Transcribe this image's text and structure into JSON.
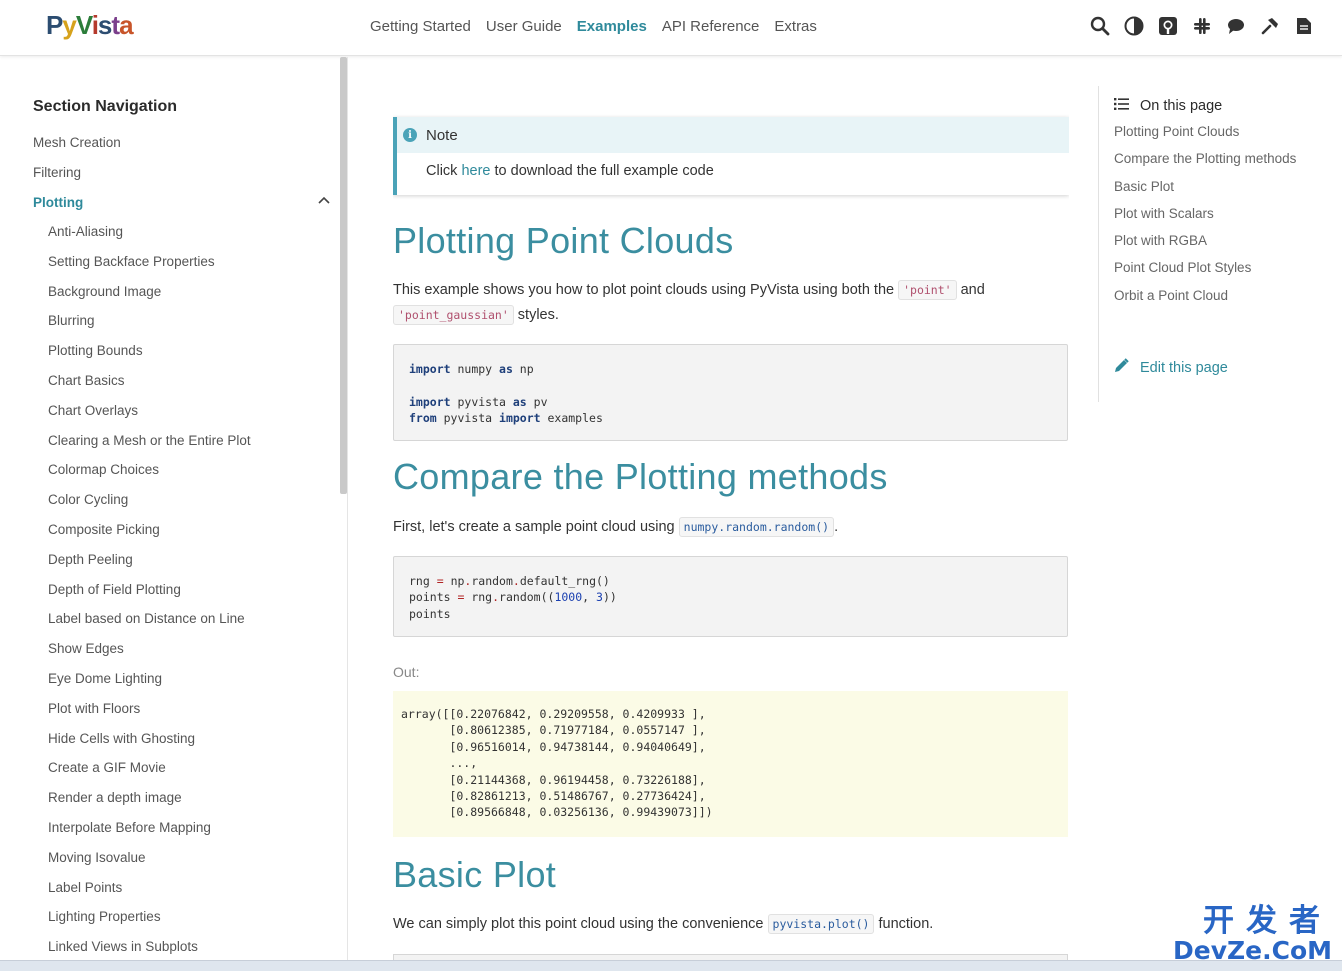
{
  "header": {
    "logo": [
      "P",
      "y",
      "V",
      "i",
      "s",
      "t",
      "a"
    ],
    "nav": [
      {
        "label": "Getting Started",
        "active": false
      },
      {
        "label": "User Guide",
        "active": false
      },
      {
        "label": "Examples",
        "active": true
      },
      {
        "label": "API Reference",
        "active": false
      },
      {
        "label": "Extras",
        "active": false
      }
    ],
    "icons": [
      "search-icon",
      "theme-toggle-icon",
      "github-icon",
      "slack-icon",
      "discussions-icon",
      "wrench-icon",
      "document-icon"
    ]
  },
  "sidebar": {
    "title": "Section Navigation",
    "items": [
      "Mesh Creation",
      "Filtering",
      "Plotting"
    ],
    "active_chevron": "^",
    "sub_items": [
      "Anti-Aliasing",
      "Setting Backface Properties",
      "Background Image",
      "Blurring",
      "Plotting Bounds",
      "Chart Basics",
      "Chart Overlays",
      "Clearing a Mesh or the Entire Plot",
      "Colormap Choices",
      "Color Cycling",
      "Composite Picking",
      "Depth Peeling",
      "Depth of Field Plotting",
      "Label based on Distance on Line",
      "Show Edges",
      "Eye Dome Lighting",
      "Plot with Floors",
      "Hide Cells with Ghosting",
      "Create a GIF Movie",
      "Render a depth image",
      "Interpolate Before Mapping",
      "Moving Isovalue",
      "Label Points",
      "Lighting Properties",
      "Linked Views in Subplots"
    ]
  },
  "main": {
    "note": {
      "icon_glyph": "i",
      "title": "Note",
      "text_before": "Click ",
      "link": "here",
      "text_after": " to download the full example code"
    },
    "h1_point_clouds": "Plotting Point Clouds",
    "intro": {
      "before": "This example shows you how to plot point clouds using PyVista using both the ",
      "code1": "'point'",
      "middle": " and ",
      "code2": "'point_gaussian'",
      "after": " styles."
    },
    "code1": {
      "l1_kw1": "import",
      "l1_rest": " numpy ",
      "l1_kw2": "as",
      "l1_end": " np",
      "l3_kw1": "import",
      "l3_rest": " pyvista ",
      "l3_kw2": "as",
      "l3_end": " pv",
      "l4_kw1": "from",
      "l4_rest": " pyvista ",
      "l4_kw2": "import",
      "l4_end": " examples"
    },
    "h1_compare": "Compare the Plotting methods",
    "compare_text": {
      "before": "First, let's create a sample point cloud using ",
      "code": "numpy.random.random()",
      "after": "."
    },
    "code2": {
      "l1_a": "rng ",
      "l1_op": "=",
      "l1_b": " np",
      "l1_op2": ".",
      "l1_c": "random",
      "l1_op3": ".",
      "l1_d": "default_rng()",
      "l2_a": "points ",
      "l2_op": "=",
      "l2_b": " rng",
      "l2_op2": ".",
      "l2_c": "random((",
      "l2_n1": "1000",
      "l2_d": ", ",
      "l2_n2": "3",
      "l2_e": "))",
      "l3": "points"
    },
    "out_label": "Out:",
    "output_lines": [
      "array([[0.22076842, 0.29209558, 0.4209933 ],",
      "       [0.80612385, 0.71977184, 0.0557147 ],",
      "       [0.96516014, 0.94738144, 0.94040649],",
      "       ...,",
      "       [0.21144368, 0.96194458, 0.73226188],",
      "       [0.82861213, 0.51486767, 0.27736424],",
      "       [0.89566848, 0.03256136, 0.99439073]])"
    ],
    "h1_basic": "Basic Plot",
    "basic_text": {
      "before": "We can simply plot this point cloud using the convenience ",
      "code": "pyvista.plot()",
      "after": " function."
    }
  },
  "toc": {
    "title": "On this page",
    "items": [
      "Plotting Point Clouds",
      "Compare the Plotting methods",
      "Basic Plot",
      "Plot with Scalars",
      "Plot with RGBA",
      "Point Cloud Plot Styles",
      "Orbit a Point Cloud"
    ],
    "edit": "Edit this page"
  },
  "watermark": {
    "line1": "开发者",
    "line2": "DevZe.CoM"
  },
  "colors": {
    "accent": "#2f8a9b",
    "heading": "#3b8ea0",
    "note_border": "#4aa3b8",
    "output_bg": "#fbfbe6"
  }
}
